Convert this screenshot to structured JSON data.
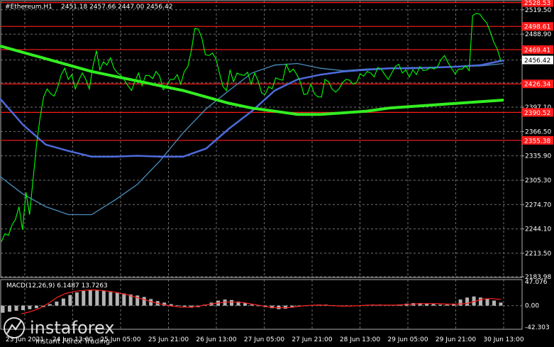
{
  "header": {
    "symbol": "#Ethereum,H1",
    "ohlc": "2451.18 2457.66 2447.00 2456.42"
  },
  "macd_label": "MACD(12,26,9) 6.1487 13.7263",
  "watermark": {
    "brand": "instaforex",
    "tagline": "Instant Forex Trading"
  },
  "colors": {
    "background": "#000000",
    "grid": "#6f6f6f",
    "price_line": "#00ff00",
    "sma_fast": "#4a8fbf",
    "sma_mid": "#4d6bdc",
    "sma_slow": "#33ee22",
    "level": "#ff1a1a",
    "histogram": "#b4b4b4",
    "signal": "#ff2020"
  },
  "chart_data": [
    {
      "type": "line",
      "name": "price",
      "ylim": [
        2183.98,
        2530.0
      ],
      "y_ticks": [
        "2519.50",
        "2488.90",
        "2456.42",
        "2427.71",
        "2397.10",
        "2366.50",
        "2335.90",
        "2305.30",
        "2274.70",
        "2244.10",
        "2213.50",
        "2183.98"
      ],
      "x_ticks": [
        "23 Jun 2021",
        "24 Jun 13:00",
        "25 Jun 05:00",
        "25 Jun 21:00",
        "26 Jun 13:00",
        "27 Jun 05:00",
        "27 Jun 21:00",
        "28 Jun 13:00",
        "29 Jun 05:00",
        "29 Jun 21:00",
        "30 Jun 13:00"
      ],
      "current_price": 2456.42,
      "levels": [
        {
          "label": "2528.53",
          "value": 2528.53
        },
        {
          "label": "2498.61",
          "value": 2498.61
        },
        {
          "label": "2469.41",
          "value": 2469.41
        },
        {
          "label": "2426.34",
          "value": 2426.34
        },
        {
          "label": "2390.52",
          "value": 2390.52
        },
        {
          "label": "2355.38",
          "value": 2355.38
        }
      ],
      "series": [
        {
          "role": "close",
          "values": [
            2228,
            2238,
            2236,
            2249,
            2256,
            2272,
            2243,
            2290,
            2262,
            2306,
            2351,
            2384,
            2410,
            2420,
            2414,
            2411,
            2422,
            2438,
            2446,
            2432,
            2438,
            2420,
            2431,
            2440,
            2432,
            2420,
            2448,
            2468,
            2444,
            2454,
            2450,
            2459,
            2446,
            2440,
            2437,
            2431,
            2424,
            2418,
            2430,
            2440,
            2424,
            2437,
            2437,
            2433,
            2442,
            2436,
            2419,
            2424,
            2432,
            2432,
            2438,
            2426,
            2442,
            2448,
            2468,
            2496,
            2495,
            2484,
            2463,
            2462,
            2465,
            2458,
            2440,
            2423,
            2418,
            2444,
            2429,
            2440,
            2438,
            2437,
            2441,
            2426,
            2440,
            2430,
            2415,
            2413,
            2423,
            2420,
            2434,
            2432,
            2431,
            2451,
            2441,
            2445,
            2438,
            2429,
            2413,
            2414,
            2426,
            2414,
            2410,
            2410,
            2432,
            2429,
            2420,
            2416,
            2420,
            2428,
            2432,
            2431,
            2426,
            2428,
            2439,
            2436,
            2442,
            2440,
            2435,
            2447,
            2445,
            2438,
            2432,
            2440,
            2448,
            2451,
            2440,
            2444,
            2435,
            2444,
            2438,
            2448,
            2443,
            2444,
            2447,
            2445,
            2448,
            2457,
            2462,
            2453,
            2446,
            2439,
            2445,
            2445,
            2449,
            2443,
            2512,
            2515,
            2514,
            2508,
            2503,
            2492,
            2479,
            2470,
            2456
          ]
        },
        {
          "role": "sma_fast",
          "values": [
            2310,
            2288,
            2272,
            2262,
            2262,
            2280,
            2300,
            2330,
            2365,
            2395,
            2418,
            2440,
            2450,
            2452,
            2446,
            2443,
            2445,
            2446,
            2447,
            2447,
            2448,
            2449,
            2452
          ]
        },
        {
          "role": "sma_mid",
          "values": [
            2408,
            2375,
            2350,
            2342,
            2335,
            2335,
            2336,
            2335,
            2335,
            2345,
            2370,
            2392,
            2418,
            2432,
            2438,
            2442,
            2444,
            2446,
            2446,
            2447,
            2448,
            2450,
            2456
          ]
        },
        {
          "role": "sma_slow",
          "values": [
            2474,
            2466,
            2458,
            2450,
            2442,
            2436,
            2430,
            2424,
            2418,
            2410,
            2402,
            2396,
            2392,
            2388,
            2388,
            2390,
            2392,
            2396,
            2398,
            2400,
            2402,
            2404,
            2406
          ]
        }
      ]
    },
    {
      "type": "bar",
      "name": "MACD(12,26,9)",
      "ylim": [
        -42.3,
        47.1
      ],
      "y_ticks": [
        "47.076",
        "0.00",
        "-42.303"
      ],
      "series": [
        {
          "role": "histogram",
          "values": [
            -14,
            -12,
            -10,
            -9,
            -7,
            -5,
            -3,
            3,
            8,
            14,
            21,
            26,
            29,
            31,
            30,
            29,
            27,
            26,
            24,
            22,
            20,
            17,
            13,
            9,
            6,
            3,
            1,
            -2,
            -4,
            -3,
            2,
            6,
            10,
            12,
            11,
            8,
            5,
            2,
            -1,
            -3,
            -5,
            -7,
            -6,
            -4,
            -2,
            0,
            1,
            2,
            2,
            1,
            0,
            -1,
            -1,
            0,
            1,
            2,
            2,
            1,
            1,
            2,
            4,
            5,
            5,
            4,
            3,
            2,
            2,
            4,
            12,
            16,
            18,
            16,
            13,
            10,
            6
          ]
        },
        {
          "role": "signal",
          "values": [
            -16,
            -12,
            -6,
            4,
            16,
            24,
            28,
            30,
            31,
            30,
            28,
            25,
            21,
            16,
            11,
            6,
            2,
            -1,
            -3,
            -3,
            -1,
            2,
            5,
            7,
            7,
            6,
            3,
            0,
            -3,
            -4,
            -4,
            -2,
            0,
            1,
            1,
            0,
            -1,
            -1,
            0,
            1,
            1,
            1,
            1,
            2,
            3,
            4,
            4,
            4,
            3,
            3,
            4,
            8,
            13,
            14,
            12
          ]
        }
      ]
    }
  ]
}
